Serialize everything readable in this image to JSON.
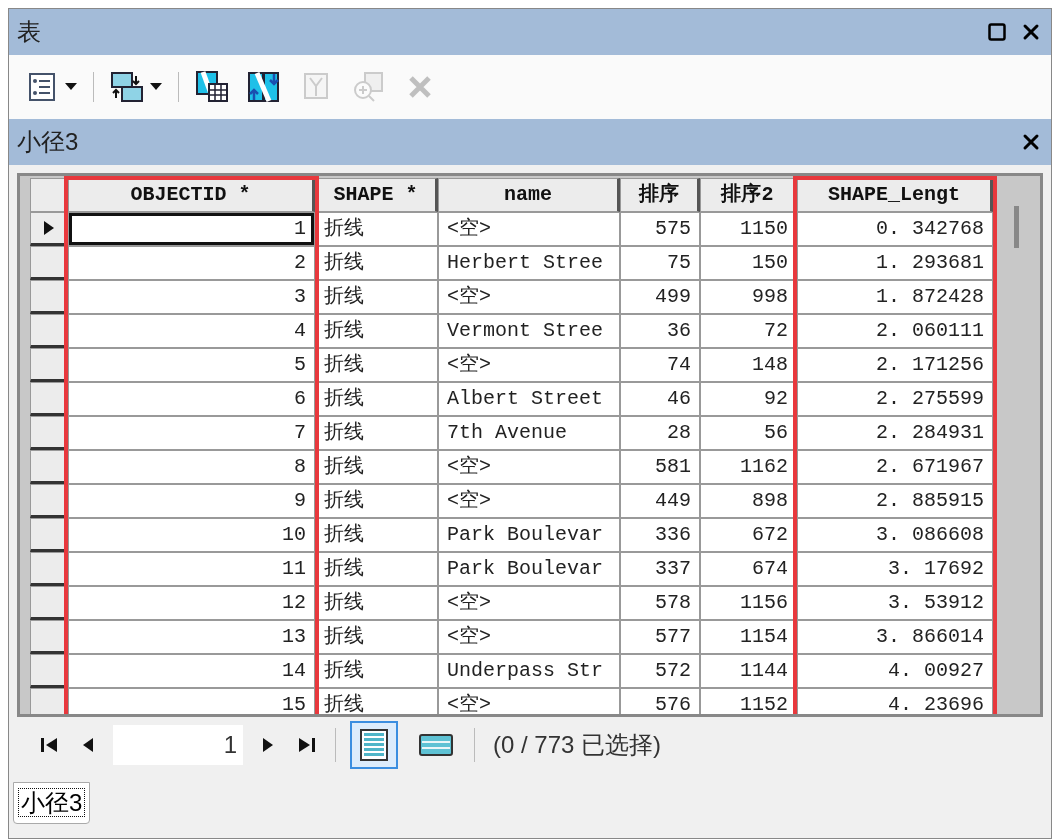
{
  "window": {
    "title": "表"
  },
  "toolbar": [
    {
      "kind": "table-options",
      "dropdown": true,
      "disabled": false
    },
    {
      "kind": "related-tables",
      "dropdown": true,
      "disabled": false
    },
    {
      "kind": "select-by-attributes",
      "dropdown": false,
      "disabled": false
    },
    {
      "kind": "switch-selection",
      "dropdown": false,
      "disabled": false
    },
    {
      "kind": "clear-selection",
      "dropdown": false,
      "disabled": true
    },
    {
      "kind": "zoom-to-selected",
      "dropdown": false,
      "disabled": true
    },
    {
      "kind": "delete",
      "dropdown": false,
      "disabled": true
    }
  ],
  "table": {
    "title": "小径3",
    "columns": [
      {
        "label": "OBJECTID *",
        "kind": "number",
        "highlighted": true
      },
      {
        "label": "SHAPE *",
        "kind": "text",
        "highlighted": false
      },
      {
        "label": "name",
        "kind": "text",
        "highlighted": false
      },
      {
        "label": "排序",
        "kind": "number",
        "highlighted": false
      },
      {
        "label": "排序2",
        "kind": "number",
        "highlighted": false
      },
      {
        "label": "SHAPE_Lengt",
        "kind": "number",
        "highlighted": true
      }
    ],
    "rows": [
      {
        "selected": true,
        "cells": [
          "1",
          "折线",
          "<空>",
          "575",
          "1150",
          "0. 342768"
        ]
      },
      {
        "selected": false,
        "cells": [
          "2",
          "折线",
          "Herbert Stree",
          "75",
          "150",
          "1. 293681"
        ]
      },
      {
        "selected": false,
        "cells": [
          "3",
          "折线",
          "<空>",
          "499",
          "998",
          "1. 872428"
        ]
      },
      {
        "selected": false,
        "cells": [
          "4",
          "折线",
          "Vermont Stree",
          "36",
          "72",
          "2. 060111"
        ]
      },
      {
        "selected": false,
        "cells": [
          "5",
          "折线",
          "<空>",
          "74",
          "148",
          "2. 171256"
        ]
      },
      {
        "selected": false,
        "cells": [
          "6",
          "折线",
          "Albert Street",
          "46",
          "92",
          "2. 275599"
        ]
      },
      {
        "selected": false,
        "cells": [
          "7",
          "折线",
          "7th Avenue",
          "28",
          "56",
          "2. 284931"
        ]
      },
      {
        "selected": false,
        "cells": [
          "8",
          "折线",
          "<空>",
          "581",
          "1162",
          "2. 671967"
        ]
      },
      {
        "selected": false,
        "cells": [
          "9",
          "折线",
          "<空>",
          "449",
          "898",
          "2. 885915"
        ]
      },
      {
        "selected": false,
        "cells": [
          "10",
          "折线",
          "Park Boulevar",
          "336",
          "672",
          "3. 086608"
        ]
      },
      {
        "selected": false,
        "cells": [
          "11",
          "折线",
          "Park Boulevar",
          "337",
          "674",
          "3. 17692"
        ]
      },
      {
        "selected": false,
        "cells": [
          "12",
          "折线",
          "<空>",
          "578",
          "1156",
          "3. 53912"
        ]
      },
      {
        "selected": false,
        "cells": [
          "13",
          "折线",
          "<空>",
          "577",
          "1154",
          "3. 866014"
        ]
      },
      {
        "selected": false,
        "cells": [
          "14",
          "折线",
          "Underpass Str",
          "572",
          "1144",
          "4. 00927"
        ]
      },
      {
        "selected": false,
        "cells": [
          "15",
          "折线",
          "<空>",
          "576",
          "1152",
          "4. 23696"
        ]
      }
    ]
  },
  "navigation": {
    "record": "1",
    "views": [
      {
        "kind": "all-records",
        "selected": true
      },
      {
        "kind": "selected-records",
        "selected": false
      }
    ],
    "status": "(0 / 773 已选择)"
  },
  "tabs": [
    {
      "label": "小径3",
      "selected": true
    }
  ]
}
